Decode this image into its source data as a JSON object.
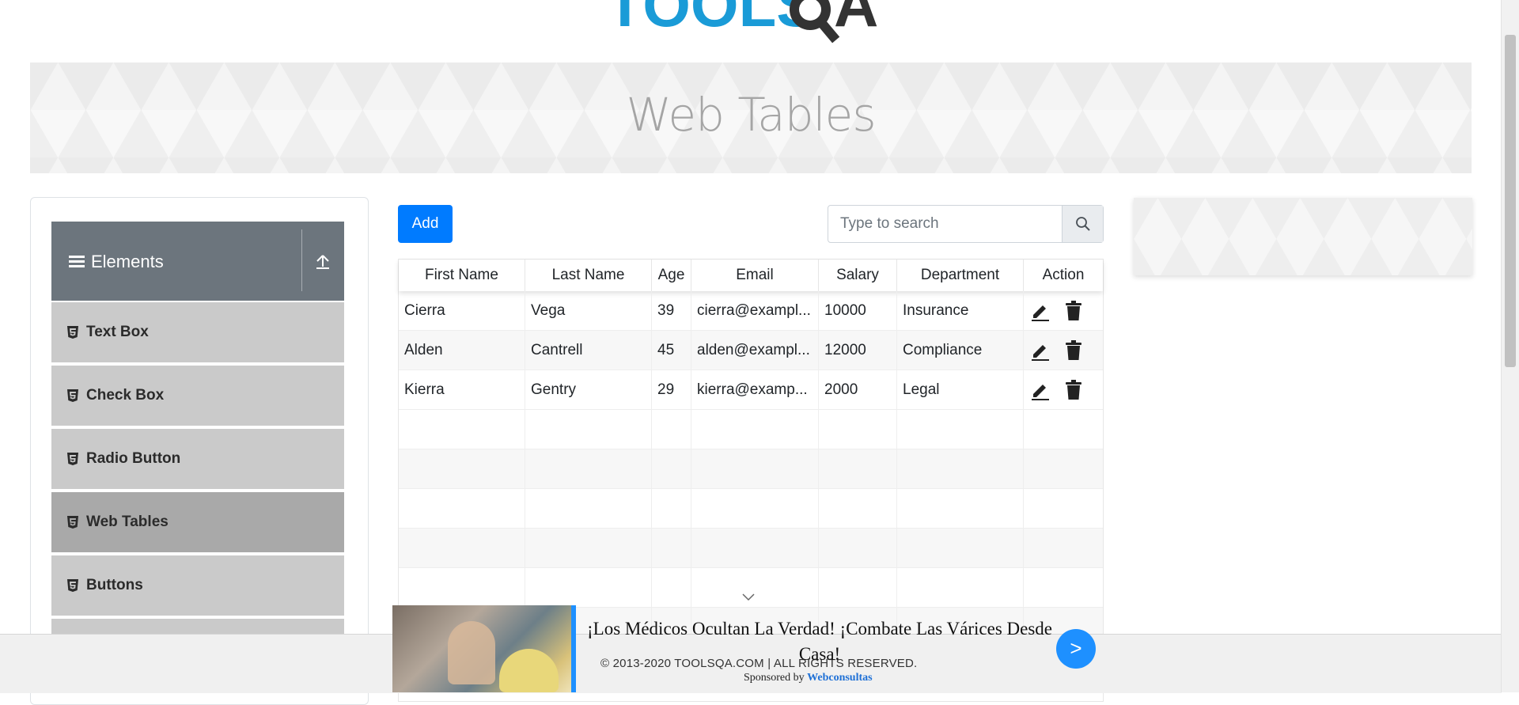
{
  "logo": {
    "text_tools": "TOOLS",
    "text_qa": "QA"
  },
  "page_title": "Web Tables",
  "sidebar": {
    "group_title": "Elements",
    "items": [
      {
        "label": "Text Box"
      },
      {
        "label": "Check Box"
      },
      {
        "label": "Radio Button"
      },
      {
        "label": "Web Tables",
        "active": true
      },
      {
        "label": "Buttons"
      }
    ]
  },
  "toolbar": {
    "add_label": "Add",
    "search_placeholder": "Type to search"
  },
  "table": {
    "columns": [
      "First Name",
      "Last Name",
      "Age",
      "Email",
      "Salary",
      "Department",
      "Action"
    ],
    "rows": [
      {
        "first": "Cierra",
        "last": "Vega",
        "age": "39",
        "email": "cierra@exampl...",
        "salary": "10000",
        "department": "Insurance"
      },
      {
        "first": "Alden",
        "last": "Cantrell",
        "age": "45",
        "email": "alden@exampl...",
        "salary": "12000",
        "department": "Compliance"
      },
      {
        "first": "Kierra",
        "last": "Gentry",
        "age": "29",
        "email": "kierra@examp...",
        "salary": "2000",
        "department": "Legal"
      }
    ]
  },
  "footer": {
    "copyright": "© 2013-2020 TOOLSQA.COM | ALL RIGHTS RESERVED."
  },
  "ad": {
    "headline": "¡Los Médicos Ocultan La Verdad! ¡Combate Las Várices Desde Casa!",
    "arrow": ">",
    "sponsored_prefix": "Sponsored by",
    "sponsor": "Webconsultas"
  },
  "colors": {
    "primary": "#007bff",
    "logo_blue": "#1a9bd7",
    "logo_dark": "#333333",
    "sidebar_header": "#6c757d",
    "menu_item": "#cacaca",
    "menu_item_active": "#a9a9a9"
  }
}
